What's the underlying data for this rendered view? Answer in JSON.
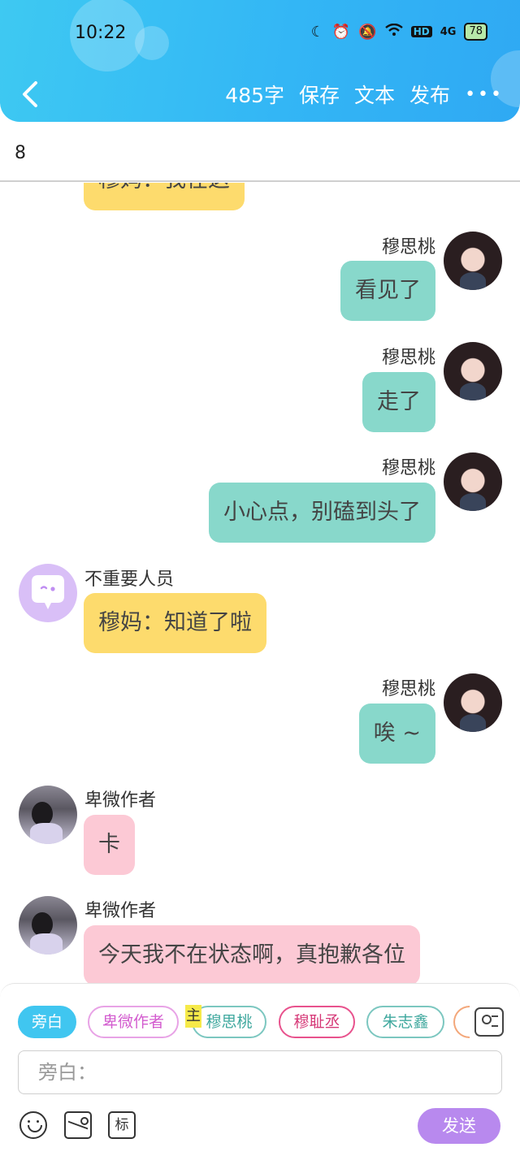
{
  "status_bar": {
    "time": "10:22",
    "battery": "78",
    "network": "4G",
    "hd": "HD"
  },
  "toolbar": {
    "word_count": "485字",
    "save": "保存",
    "text": "文本",
    "publish": "发布",
    "more": "•••"
  },
  "title_input": {
    "value": "8"
  },
  "partial_top": {
    "text": "穆妈：我在这"
  },
  "messages": [
    {
      "side": "right",
      "name": "穆思桃",
      "text": "看见了",
      "color": "#88d8cb"
    },
    {
      "side": "right",
      "name": "穆思桃",
      "text": "走了",
      "color": "#88d8cb"
    },
    {
      "side": "right",
      "name": "穆思桃",
      "text": "小心点，别磕到头了",
      "color": "#88d8cb"
    },
    {
      "side": "left",
      "name": "不重要人员",
      "text": "穆妈：知道了啦",
      "color": "#fddb6d"
    },
    {
      "side": "right",
      "name": "穆思桃",
      "text": "唉 ~",
      "color": "#88d8cb"
    },
    {
      "side": "left",
      "name": "卑微作者",
      "text": "卡",
      "color": "#fcc9d5"
    },
    {
      "side": "left",
      "name": "卑微作者",
      "text": "今天我不在状态啊，真抱歉各位",
      "color": "#fcc9d5"
    }
  ],
  "roles": [
    {
      "label": "旁白",
      "selected": true
    },
    {
      "label": "卑微作者"
    },
    {
      "label": "穆思桃",
      "tag": "主"
    },
    {
      "label": "穆耻丞"
    },
    {
      "label": "朱志鑫"
    }
  ],
  "input": {
    "placeholder": "旁白："
  },
  "tools": {
    "mark_label": "标"
  },
  "send_label": "发送"
}
